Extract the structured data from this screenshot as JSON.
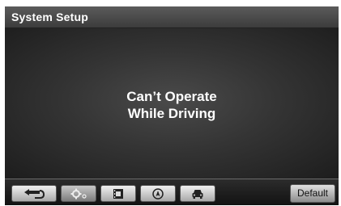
{
  "header": {
    "title": "System Setup"
  },
  "main": {
    "message_line1": "Can’t Operate",
    "message_line2": "While Driving"
  },
  "toolbar": {
    "icons": [
      "back-arrow-icon",
      "settings-gear-icon",
      "media-icon",
      "navigation-icon",
      "vehicle-icon"
    ],
    "default_label": "Default"
  }
}
